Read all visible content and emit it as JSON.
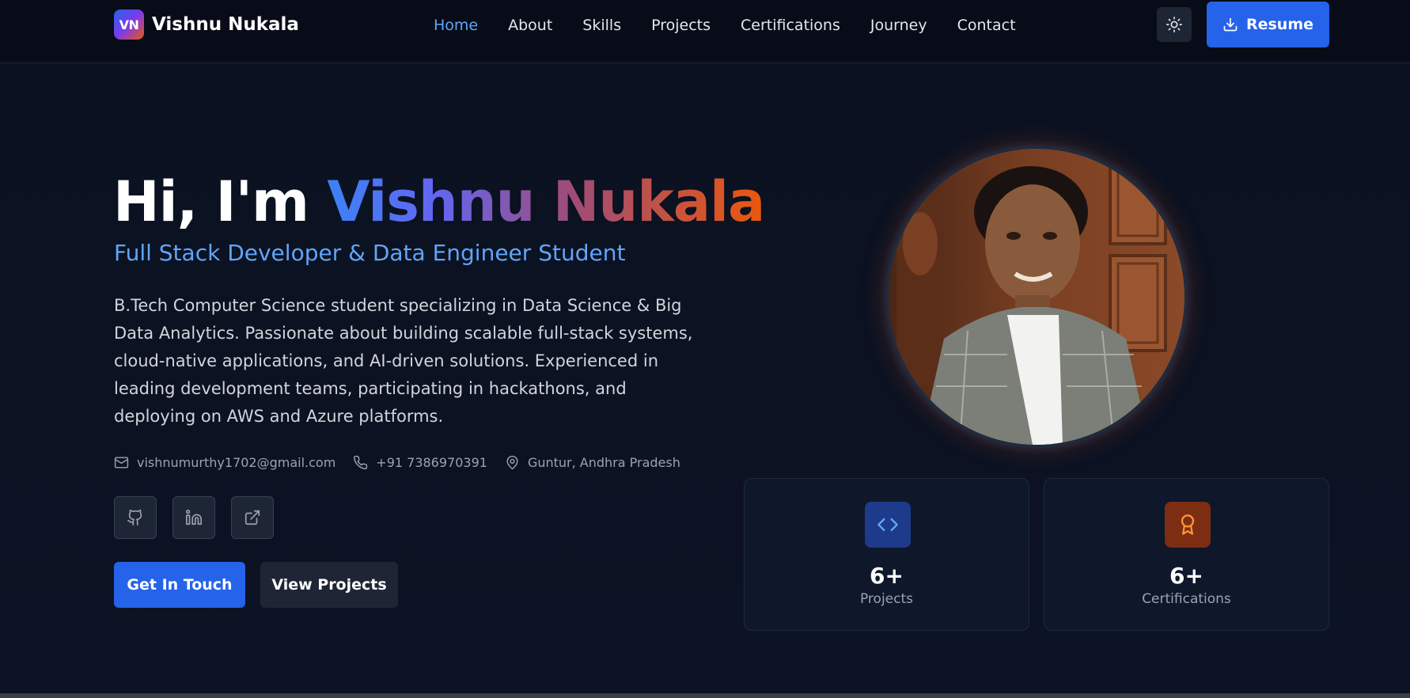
{
  "navbar": {
    "logo_initials": "VN",
    "brand_name": "Vishnu Nukala",
    "links": [
      {
        "label": "Home",
        "active": true
      },
      {
        "label": "About",
        "active": false
      },
      {
        "label": "Skills",
        "active": false
      },
      {
        "label": "Projects",
        "active": false
      },
      {
        "label": "Certifications",
        "active": false
      },
      {
        "label": "Journey",
        "active": false
      },
      {
        "label": "Contact",
        "active": false
      }
    ],
    "theme_toggle_icon": "sun-icon",
    "resume_label": "Resume",
    "resume_icon": "download-icon"
  },
  "hero": {
    "title_prefix": "Hi, I'm ",
    "title_name": "Vishnu Nukala",
    "subtitle": "Full Stack Developer & Data Engineer Student",
    "description": "B.Tech Computer Science student specializing in Data Science & Big Data Analytics. Passionate about building scalable full-stack systems, cloud-native applications, and AI-driven solutions. Experienced in leading development teams, participating in hackathons, and deploying on AWS and Azure platforms.",
    "contact": {
      "email": "vishnumurthy1702@gmail.com",
      "phone": "+91 7386970391",
      "location": "Guntur, Andhra Pradesh"
    },
    "social": [
      "github-icon",
      "linkedin-icon",
      "external-link-icon"
    ],
    "primary_cta": "Get In Touch",
    "secondary_cta": "View Projects"
  },
  "stats": [
    {
      "value": "6+",
      "label": "Projects",
      "icon": "code-icon"
    },
    {
      "value": "6+",
      "label": "Certifications",
      "icon": "award-icon"
    }
  ],
  "colors": {
    "background": "#0b1120",
    "accent_blue": "#2563eb",
    "link_active": "#60a5fa",
    "accent_orange": "#ea580c"
  }
}
